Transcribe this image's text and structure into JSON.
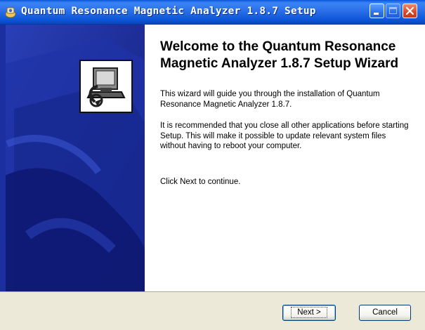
{
  "window": {
    "title": "Quantum Resonance Magnetic Analyzer 1.8.7 Setup"
  },
  "content": {
    "heading": "Welcome to the Quantum Resonance Magnetic Analyzer 1.8.7 Setup Wizard",
    "intro": "This wizard will guide you through the installation of Quantum Resonance Magnetic Analyzer 1.8.7.",
    "recommendation": "It is recommended that you close all other applications before starting Setup. This will make it possible to update relevant system files without having to reboot your computer.",
    "continue_hint": "Click Next to continue."
  },
  "buttons": {
    "next_label": "Next >",
    "cancel_label": "Cancel"
  },
  "icons": {
    "app": "installer-app-icon",
    "banner": "computer-install-icon",
    "minimize": "minimize-icon",
    "maximize": "maximize-icon",
    "close": "close-icon"
  },
  "colors": {
    "titlebar": "#2b6fe8",
    "banner": "#1a2e9c",
    "panel": "#ece9d8"
  }
}
